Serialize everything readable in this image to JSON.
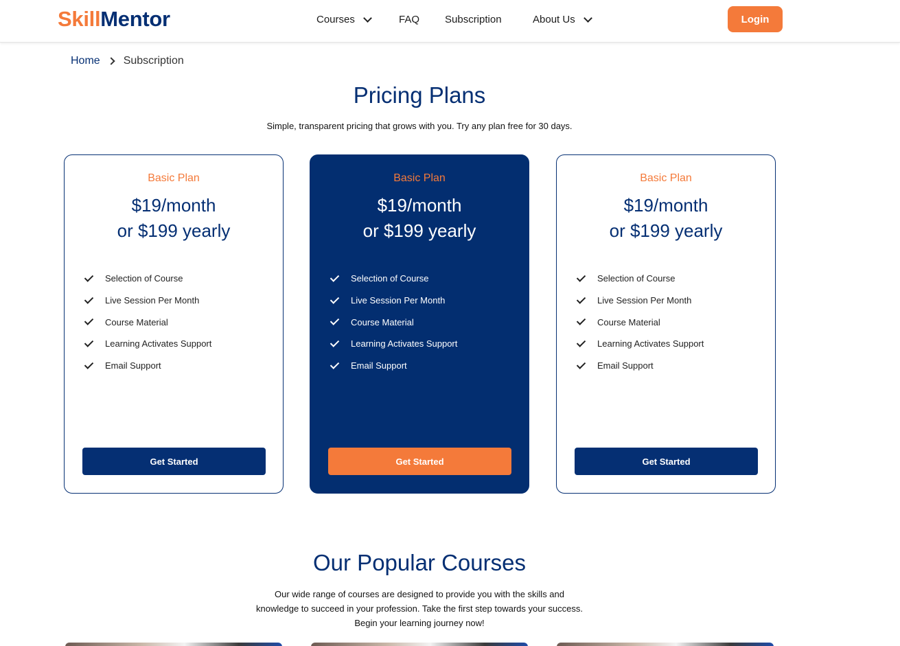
{
  "header": {
    "logo_part1": "Skill",
    "logo_part2": "Mentor",
    "nav": {
      "courses": "Courses",
      "faq": "FAQ",
      "subscription": "Subscription",
      "about": "About Us"
    },
    "login": "Login"
  },
  "breadcrumb": {
    "home": "Home",
    "current": "Subscription"
  },
  "pricing": {
    "title": "Pricing Plans",
    "subtitle": "Simple, transparent pricing that grows with you. Try any plan free for 30 days.",
    "plans": [
      {
        "name": "Basic Plan",
        "price_monthly": "$19/month",
        "price_yearly": "or $199 yearly",
        "features": [
          "Selection of Course",
          "Live Session Per Month",
          "Course Material",
          "Learning Activates Support",
          "Email Support"
        ],
        "cta": "Get Started"
      },
      {
        "name": "Basic Plan",
        "price_monthly": "$19/month",
        "price_yearly": "or $199 yearly",
        "features": [
          "Selection of Course",
          "Live Session Per Month",
          "Course Material",
          "Learning Activates Support",
          "Email Support"
        ],
        "cta": "Get Started"
      },
      {
        "name": "Basic Plan",
        "price_monthly": "$19/month",
        "price_yearly": "or $199 yearly",
        "features": [
          "Selection of Course",
          "Live Session Per Month",
          "Course Material",
          "Learning Activates Support",
          "Email Support"
        ],
        "cta": "Get Started"
      }
    ]
  },
  "courses": {
    "title": "Our Popular Courses",
    "subtitle": "Our wide range of courses are designed to provide you with the skills and knowledge to succeed in your profession. Take the first step towards your success. Begin your learning journey now!"
  },
  "colors": {
    "brand_navy": "#052f73",
    "brand_orange": "#f47a3a"
  }
}
